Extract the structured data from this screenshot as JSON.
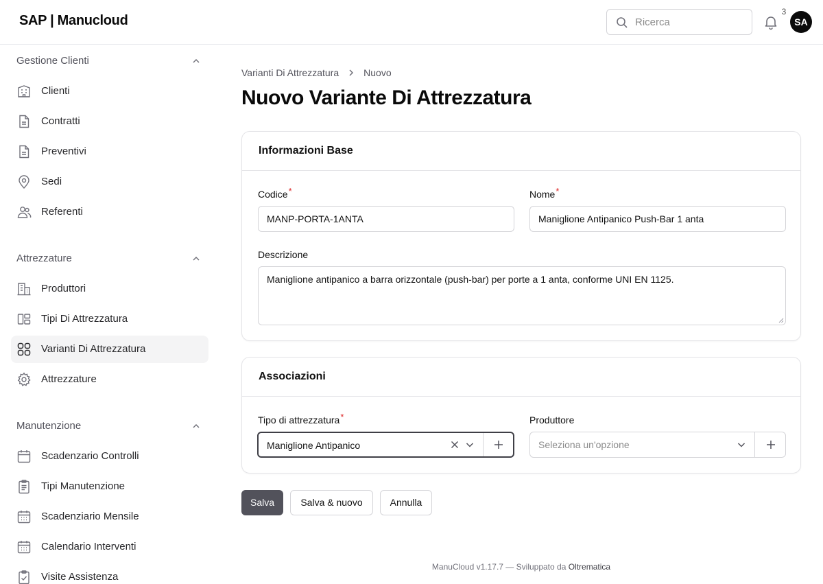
{
  "app": {
    "brand": "SAP | Manucloud"
  },
  "header": {
    "search_placeholder": "Ricerca",
    "notification_count": "3",
    "avatar_initials": "SA"
  },
  "sidebar": {
    "groups": [
      {
        "title": "Gestione Clienti",
        "items": [
          {
            "label": "Clienti",
            "icon": "building-icon"
          },
          {
            "label": "Contratti",
            "icon": "document-icon"
          },
          {
            "label": "Preventivi",
            "icon": "document-icon"
          },
          {
            "label": "Sedi",
            "icon": "map-pin-icon"
          },
          {
            "label": "Referenti",
            "icon": "users-icon"
          }
        ]
      },
      {
        "title": "Attrezzature",
        "items": [
          {
            "label": "Produttori",
            "icon": "office-building-icon"
          },
          {
            "label": "Tipi Di Attrezzatura",
            "icon": "shapes-icon"
          },
          {
            "label": "Varianti Di Attrezzatura",
            "icon": "grid-circles-icon",
            "active": true
          },
          {
            "label": "Attrezzature",
            "icon": "gear-icon"
          }
        ]
      },
      {
        "title": "Manutenzione",
        "items": [
          {
            "label": "Scadenzario Controlli",
            "icon": "calendar-icon"
          },
          {
            "label": "Tipi Manutenzione",
            "icon": "clipboard-icon"
          },
          {
            "label": "Scadenziario Mensile",
            "icon": "calendar-days-icon"
          },
          {
            "label": "Calendario Interventi",
            "icon": "calendar-days-icon"
          },
          {
            "label": "Visite Assistenza",
            "icon": "clipboard-check-icon"
          }
        ]
      }
    ]
  },
  "breadcrumb": {
    "parent": "Varianti Di Attrezzatura",
    "current": "Nuovo"
  },
  "page": {
    "title": "Nuovo Variante Di Attrezzatura"
  },
  "form": {
    "base_section": {
      "title": "Informazioni Base",
      "codice_label": "Codice",
      "codice_value": "MANP-PORTA-1ANTA",
      "nome_label": "Nome",
      "nome_value": "Maniglione Antipanico Push-Bar 1 anta",
      "descrizione_label": "Descrizione",
      "descrizione_value": "Maniglione antipanico a barra orizzontale (push-bar) per porte a 1 anta, conforme UNI EN 1125.",
      "required_mark": "*"
    },
    "assoc_section": {
      "title": "Associazioni",
      "tipo_label": "Tipo di attrezzatura",
      "tipo_value": "Maniglione Antipanico",
      "produttore_label": "Produttore",
      "produttore_placeholder": "Seleziona un'opzione",
      "required_mark": "*"
    },
    "actions": {
      "save": "Salva",
      "save_new": "Salva & nuovo",
      "cancel": "Annulla"
    }
  },
  "footer": {
    "text": "ManuCloud v1.17.7 — Sviluppato da",
    "link": "Oltrematica"
  },
  "colors": {
    "primary_button": "#52525b",
    "required": "#dc2626",
    "active_nav_bg": "#f4f4f5"
  }
}
